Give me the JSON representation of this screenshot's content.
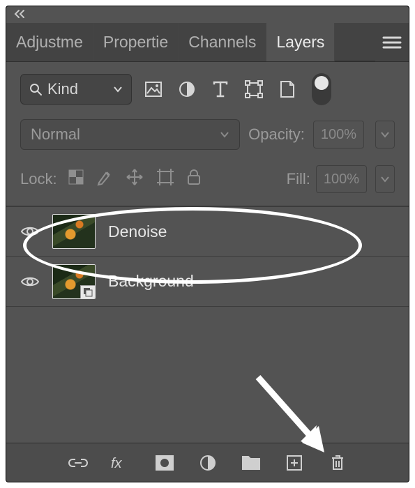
{
  "panel": {
    "tabs": [
      "Adjustme",
      "Propertie",
      "Channels",
      "Layers"
    ],
    "activeTabIndex": 3
  },
  "filter": {
    "kind_label": "Kind",
    "icons": [
      "image-filter-icon",
      "adjustment-filter-icon",
      "type-filter-icon",
      "shape-filter-icon",
      "smartobject-filter-icon"
    ]
  },
  "blend": {
    "mode": "Normal",
    "opacity_label": "Opacity:",
    "opacity_value": "100%"
  },
  "lock": {
    "label": "Lock:",
    "fill_label": "Fill:",
    "fill_value": "100%"
  },
  "layers": [
    {
      "name": "Denoise",
      "visible": true,
      "smart": false
    },
    {
      "name": "Background",
      "visible": true,
      "smart": true
    }
  ],
  "bottomIcons": [
    "link-layers-icon",
    "layer-effects-icon",
    "layer-mask-icon",
    "adjustment-layer-icon",
    "group-icon",
    "new-layer-icon",
    "delete-layer-icon"
  ]
}
